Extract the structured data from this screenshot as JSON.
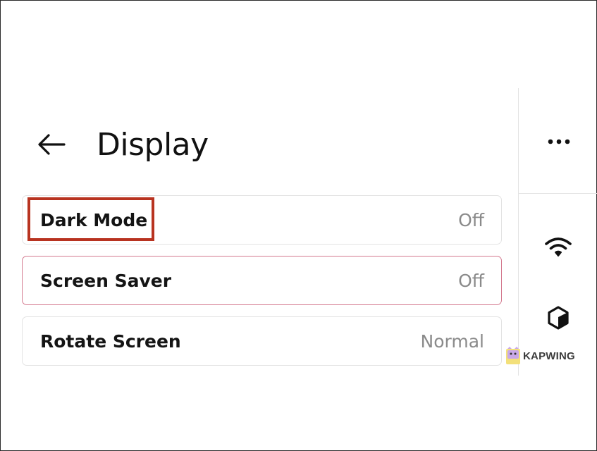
{
  "header": {
    "title": "Display",
    "back_icon": "arrow-left-icon"
  },
  "settings": [
    {
      "label": "Dark Mode",
      "value": "Off",
      "highlighted": true
    },
    {
      "label": "Screen Saver",
      "value": "Off",
      "focused": true
    },
    {
      "label": "Rotate Screen",
      "value": "Normal"
    }
  ],
  "side_panel": {
    "more_icon": "more-horizontal-icon",
    "wifi_icon": "wifi-icon",
    "cube_icon": "cube-icon"
  },
  "watermark": {
    "text": "KAPWING"
  },
  "colors": {
    "highlight_border": "#b83320",
    "focus_border": "#d47a8f",
    "value_text": "#8a8a8a"
  }
}
